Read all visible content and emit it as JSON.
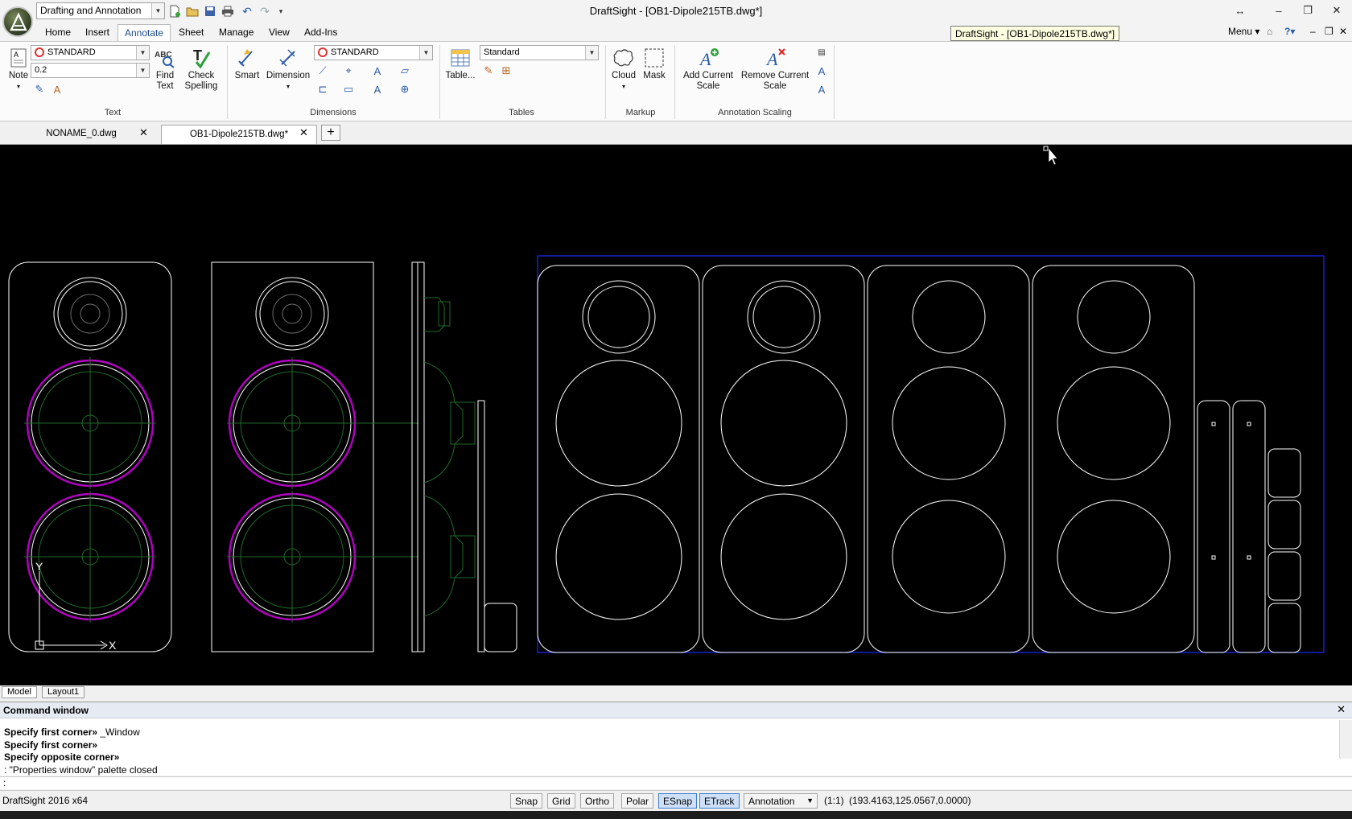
{
  "window": {
    "title": "DraftSight - [OB1-Dipole215TB.dwg*]",
    "workspace": "Drafting and Annotation",
    "tooltip": "DraftSight - [OB1-Dipole215TB.dwg*]"
  },
  "menu": {
    "tabs": [
      "Home",
      "Insert",
      "Annotate",
      "Sheet",
      "Manage",
      "View",
      "Add-Ins"
    ],
    "active": "Annotate",
    "menu_label": "Menu"
  },
  "ribbon": {
    "text": {
      "title": "Text",
      "style_combo": "STANDARD",
      "height_combo": "0.2",
      "note_label": "Note",
      "find_label": "Find\nText",
      "spell_label": "Check\nSpelling"
    },
    "dimensions": {
      "title": "Dimensions",
      "smart_label": "Smart",
      "dimension_label": "Dimension",
      "style_combo": "STANDARD"
    },
    "tables": {
      "title": "Tables",
      "table_label": "Table...",
      "style_combo": "Standard"
    },
    "markup": {
      "title": "Markup",
      "cloud_label": "Cloud",
      "mask_label": "Mask"
    },
    "scaling": {
      "title": "Annotation Scaling",
      "add_label": "Add Current\nScale",
      "remove_label": "Remove Current\nScale"
    }
  },
  "documents": [
    {
      "name": "NONAME_0.dwg",
      "active": false
    },
    {
      "name": "OB1-Dipole215TB.dwg*",
      "active": true
    }
  ],
  "layouts": [
    "Model",
    "Layout1"
  ],
  "command_window": {
    "title": "Command window",
    "lines": [
      {
        "bold": "Specify first corner»",
        "rest": " _Window"
      },
      {
        "bold": "Specify first corner»",
        "rest": ""
      },
      {
        "bold": "Specify opposite corner»",
        "rest": ""
      },
      {
        "bold": "",
        "rest": ": \"Properties window\" palette closed"
      }
    ],
    "prompt": ":"
  },
  "status": {
    "app": "DraftSight 2016 x64",
    "toggles": [
      {
        "label": "Snap",
        "on": false
      },
      {
        "label": "Grid",
        "on": false
      },
      {
        "label": "Ortho",
        "on": false
      },
      {
        "label": "Polar",
        "on": false
      },
      {
        "label": "ESnap",
        "on": true
      },
      {
        "label": "ETrack",
        "on": true
      }
    ],
    "annotation": "Annotation",
    "scale": "(1:1)",
    "coordinates": "(193.4163,125.0567,0.0000)"
  },
  "colors": {
    "canvas": "#000000",
    "selection": "#1a2cff",
    "driver_ring": "#b000c0",
    "driver_detail": "#1f6a2a"
  }
}
